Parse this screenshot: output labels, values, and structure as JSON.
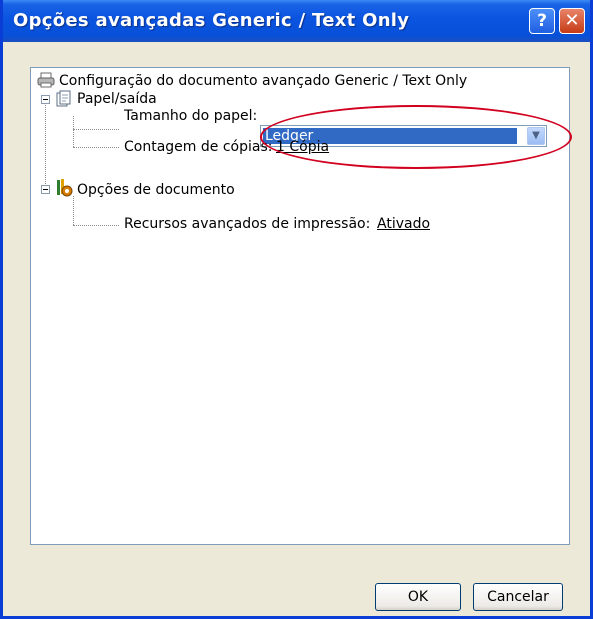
{
  "window": {
    "title": "Opções avançadas Generic / Text Only"
  },
  "titlebar_buttons": {
    "help": "?",
    "close": "✕"
  },
  "tree": {
    "root": {
      "label": "Configuração do documento avançado Generic / Text Only",
      "icon": "printer-icon"
    },
    "paper_output": {
      "label": "Papel/saída",
      "icon": "paper-icon",
      "paper_size": {
        "label": "Tamanho do papel:",
        "value": "Ledger"
      },
      "copy_count": {
        "label": "Contagem de cópias:",
        "value": "1 Cópia"
      }
    },
    "document_options": {
      "label": "Opções de documento",
      "icon": "document-options-icon",
      "advanced_printing": {
        "label": "Recursos avançados de impressão:",
        "value": "Ativado"
      }
    }
  },
  "buttons": {
    "ok": "OK",
    "cancel": "Cancelar"
  },
  "colors": {
    "titlebar": "#0a54e0",
    "selection": "#316ac5",
    "annotation": "#d2001f",
    "dialog_bg": "#ece9d8"
  }
}
